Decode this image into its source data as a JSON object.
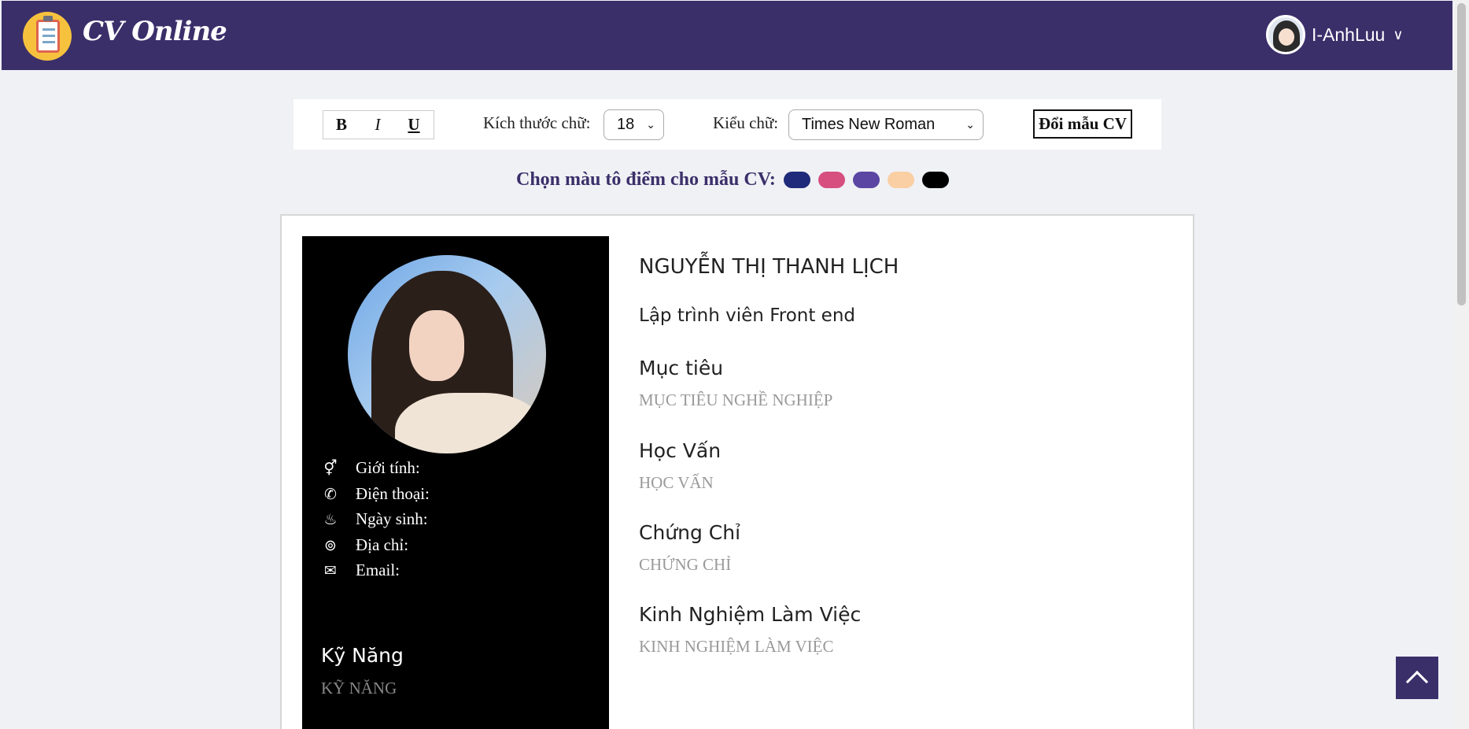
{
  "header": {
    "brand": "CV Online",
    "username": "I-AnhLuu",
    "chevron": "∨"
  },
  "toolbar": {
    "bold": "B",
    "italic": "I",
    "underline": "U",
    "font_size_label": "Kích thước chữ:",
    "font_size_value": "18",
    "font_family_label": "Kiểu chữ:",
    "font_family_value": "Times New Roman",
    "change_template_label": "Đổi mẫu CV"
  },
  "color_picker": {
    "label": "Chọn màu tô điểm cho mẫu CV:",
    "colors": [
      "#1f2a7a",
      "#d64f7e",
      "#5b46a3",
      "#f9cfa3",
      "#000000"
    ]
  },
  "cv": {
    "personal": [
      {
        "icon": "gender-icon",
        "label": "Giới tính:"
      },
      {
        "icon": "phone-icon",
        "label": "Điện thoại:"
      },
      {
        "icon": "birthday-cake-icon",
        "label": "Ngày sinh:"
      },
      {
        "icon": "location-pin-icon",
        "label": "Địa chỉ:"
      },
      {
        "icon": "envelope-icon",
        "label": "Email:"
      }
    ],
    "skills_title": "Kỹ Năng",
    "skills_placeholder": "KỸ NĂNG",
    "name": "NGUYỄN THỊ THANH LỊCH",
    "role": "Lập trình viên Front end",
    "sections": [
      {
        "title": "Mục tiêu",
        "placeholder": "MỤC TIÊU NGHỀ NGHIỆP"
      },
      {
        "title": "Học Vấn",
        "placeholder": "HỌC VẤN"
      },
      {
        "title": "Chứng Chỉ",
        "placeholder": "CHỨNG CHỈ"
      },
      {
        "title": "Kinh Nghiệm Làm Việc",
        "placeholder": "KINH NGHIỆM LÀM VIỆC"
      }
    ]
  }
}
